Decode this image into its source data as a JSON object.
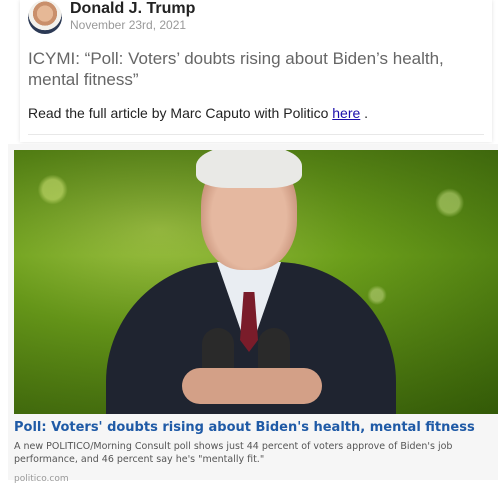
{
  "post": {
    "author": "Donald J. Trump",
    "date": "November 23rd, 2021",
    "body": "ICYMI: “Poll: Voters’ doubts rising about Biden’s health, mental fitness”",
    "link_line_prefix": "Read the full article by Marc Caputo with Politico ",
    "link_text": "here",
    "link_line_suffix": " ."
  },
  "card": {
    "title": "Poll: Voters' doubts rising about Biden's health, mental fitness",
    "description": "A new POLITICO/Morning Consult poll shows just 44 percent of voters approve of Biden's job performance, and 46 percent say he's \"mentally fit.\"",
    "source": "politico.com"
  },
  "colors": {
    "card_title": "#1f5aa6",
    "link": "#1a0dab",
    "date": "#999999"
  }
}
